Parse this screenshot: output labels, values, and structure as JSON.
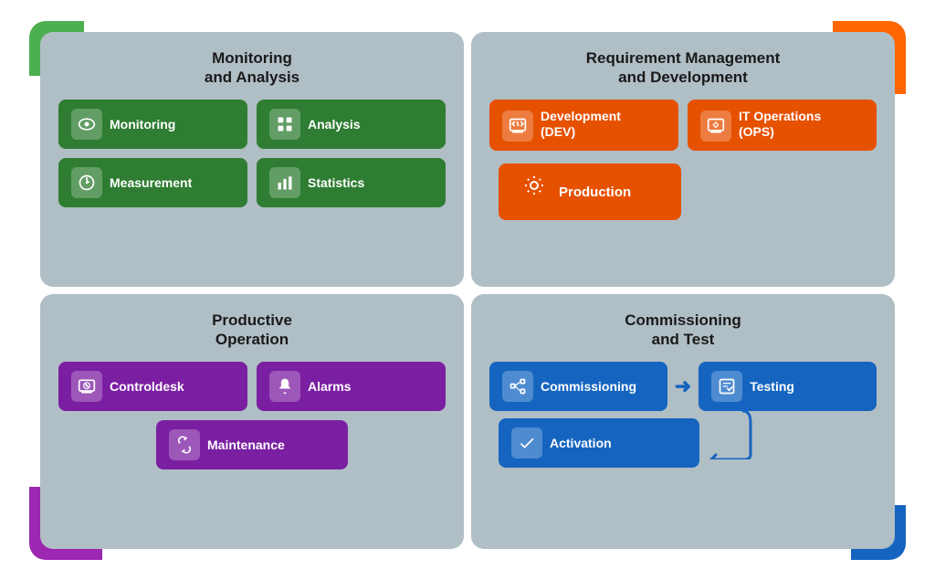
{
  "quadrants": {
    "monitoring": {
      "title": "Monitoring\nand Analysis",
      "buttons": [
        {
          "label": "Monitoring",
          "icon": "👁",
          "color": "green"
        },
        {
          "label": "Analysis",
          "icon": "🗂",
          "color": "green"
        },
        {
          "label": "Measurement",
          "icon": "⏱",
          "color": "green"
        },
        {
          "label": "Statistics",
          "icon": "📊",
          "color": "green"
        }
      ]
    },
    "requirement": {
      "title": "Requirement Management\nand Development",
      "buttons_top": [
        {
          "label": "Development\n(DEV)",
          "icon": "</>",
          "color": "orange"
        },
        {
          "label": "IT Operations\n(OPS)",
          "icon": "⚙",
          "color": "orange"
        }
      ],
      "button_bottom": {
        "label": "Production",
        "icon": "⚙",
        "color": "orange"
      }
    },
    "productive": {
      "title": "Productive\nOperation",
      "buttons_top": [
        {
          "label": "Controldesk",
          "icon": "⏻",
          "color": "purple"
        },
        {
          "label": "Alarms",
          "icon": "🔔",
          "color": "purple"
        }
      ],
      "button_bottom": {
        "label": "Maintenance",
        "icon": "🔧",
        "color": "purple"
      }
    },
    "commissioning": {
      "title": "Commissioning\nand Test",
      "btn_commissioning": {
        "label": "Commissioning",
        "icon": "⬛",
        "color": "blue"
      },
      "btn_testing": {
        "label": "Testing",
        "icon": "✏",
        "color": "blue"
      },
      "btn_activation": {
        "label": "Activation",
        "icon": "✔",
        "color": "blue"
      }
    }
  },
  "colors": {
    "green": "#2e7d32",
    "orange": "#e65100",
    "purple": "#7b1fa2",
    "blue": "#1565c0",
    "corner_green": "#4caf50",
    "corner_orange": "#ff6600",
    "corner_purple": "#9c27b0",
    "corner_blue": "#1565c0",
    "bg": "#b0bec5"
  }
}
